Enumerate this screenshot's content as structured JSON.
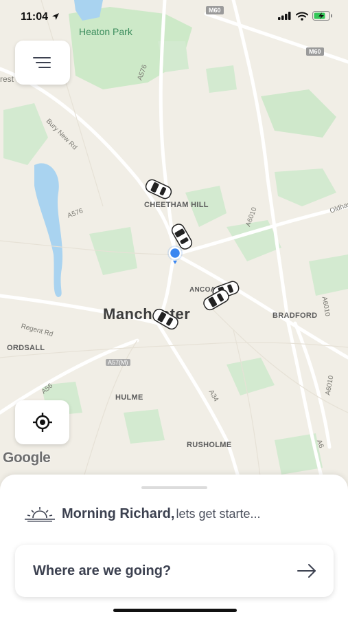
{
  "status_bar": {
    "time": "11:04",
    "icons": [
      "location-arrow-icon",
      "signal-icon",
      "wifi-icon",
      "battery-charging-icon"
    ]
  },
  "map": {
    "park_label": "Heaton Park",
    "city_label": "Manchester",
    "areas": [
      "CHEETHAM HILL",
      "ANCOATS",
      "BRADFORD",
      "ORDSALL",
      "HULME",
      "RUSHOLME"
    ],
    "roads": [
      "A576",
      "Bury New Rd",
      "A576",
      "A6010",
      "Oldham",
      "Regent Rd",
      "A57(M)",
      "A56",
      "A34",
      "A6010",
      "A6010",
      "A6",
      "rest"
    ],
    "motorways": [
      "M60",
      "M60"
    ],
    "attribution": "Google"
  },
  "sheet": {
    "greeting_name": "Morning Richard,",
    "greeting_rest": "lets get starte...",
    "search_prompt": "Where are we going?"
  },
  "colors": {
    "map_background": "#f1eee6",
    "park_green": "#c9e7c4",
    "water": "#a9d3f0",
    "location_dot": "#3a86f0",
    "text_dark": "#3c4150"
  }
}
